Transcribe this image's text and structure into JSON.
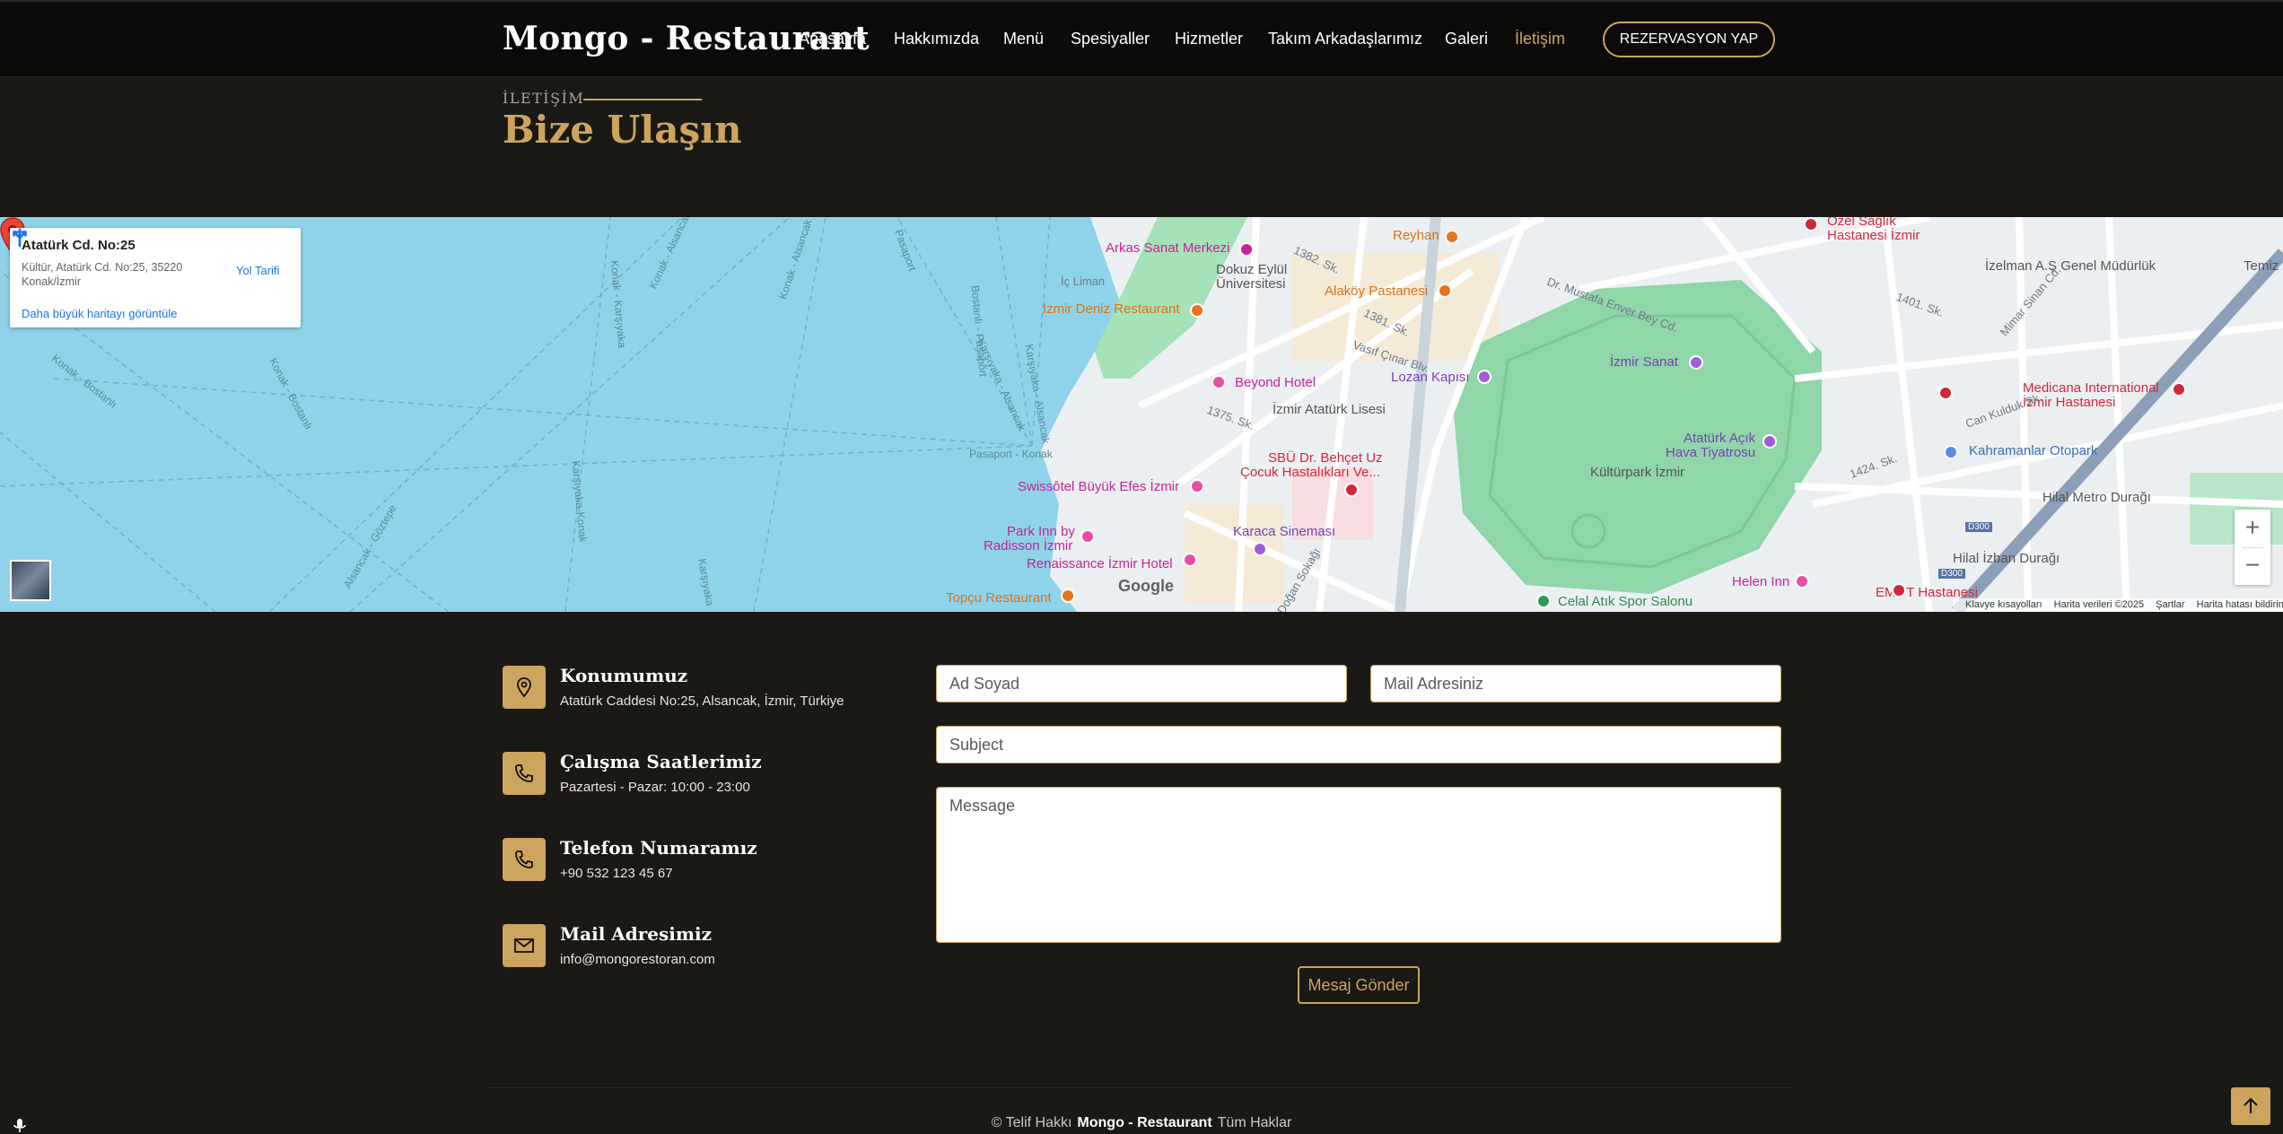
{
  "header": {
    "brand": "Mongo - Restaurant",
    "nav": [
      "Anasayfa",
      "Hakkımızda",
      "Menü",
      "Spesiyaller",
      "Hizmetler",
      "Takım Arkadaşlarımız",
      "Galeri",
      "İletişim"
    ],
    "active_nav": "İletişim",
    "reservation_label": "REZERVASYON YAP"
  },
  "section": {
    "eyebrow": "İLETİŞİM",
    "title": "Bize Ulaşın"
  },
  "map": {
    "card_title": "Atatürk Cd. No:25",
    "card_address": "Kültür, Atatürk Cd. No:25, 35220 Konak/İzmir",
    "directions_label": "Yol Tarifi",
    "bigger_map_link": "Daha büyük haritayı görüntüle",
    "google_logo": "Google",
    "attribution": [
      "Klavye kısayolları",
      "Harita verileri ©2025",
      "Şartlar",
      "Harita hatası bildirin"
    ],
    "labels": {
      "arkas": "Arkas Sanat Merkezi",
      "reyhan": "Reyhan",
      "dokuz1": "Dokuz Eylül",
      "dokuz2": "Üniversitesi",
      "alakoy": "Alaköy Pastanesi",
      "ic_liman": "İç Liman",
      "deniz_rest": "İzmir Deniz Restaurant",
      "beyond": "Beyond Hotel",
      "lozan": "Lozan Kapısı",
      "izmir_sanat": "İzmir Sanat",
      "ataturk_lisesi": "İzmir Atatürk Lisesi",
      "sbu1": "SBÜ Dr. Behçet Uz",
      "sbu2": "Çocuk Hastalıkları Ve...",
      "swissotel": "Swissôtel Büyük Efes İzmir",
      "park_inn1": "Park Inn by",
      "park_inn2": "Radisson İzmir",
      "renaissance": "Renaissance İzmir Hotel",
      "karaca": "Karaca Sineması",
      "topcu": "Topçu Restaurant",
      "kulturpark": "Kültürpark İzmir",
      "acik_hava1": "Atatürk Açık",
      "acik_hava2": "Hava Tiyatrosu",
      "ozel_saglik1": "Özel Sağlık",
      "ozel_saglik2": "Hastanesi İzmir",
      "izelman": "İzelman A.Ş Genel Müdürlük",
      "medicana1": "Medicana International",
      "medicana2": "İzmir Hastanesi",
      "kahramanlar": "Kahramanlar Otopark",
      "hilal_metro": "Hilal Metro Durağı",
      "hilal_izban": "Hilal İzban Durağı",
      "helen": "Helen Inn",
      "emot": "EMOT Hastanesi",
      "celal": "Celal Atık Spor Salonu",
      "pasaport": "Pasaport - Konak",
      "mustafa": "Dr. Mustafa Enver Bey Cd.",
      "vasif": "Vasıf Çınar Blv.",
      "sk1375": "1375. Sk.",
      "sk1382": "1382. Sk.",
      "sk1381": "1381. Sk.",
      "sk1401": "1401. Sk.",
      "sk1424": "1424. Sk.",
      "can_kulduk": "Can Kulduk Sk.",
      "mimar_sinan": "Mimar Sinan Cd.",
      "dogan": "Doğan Sokağı",
      "temiz": "Temiz",
      "d300": "D300",
      "sea_konak_bostanli": "Konak - Bostanlı",
      "sea_konak_karsiyaka": "Konak - Karşıyaka",
      "sea_karsiyaka_konak": "Karşıyaka-Konak",
      "sea_alsancak": "Alsancak - Göztepe",
      "sea_pasaport": "Pasaport",
      "sea_bostanli_pasaport": "Bostanlı - Pasaport",
      "sea_karsiyaka_alsancak": "Karşıyaka - Alsancak",
      "sea_konak": "Konak - Alsancak",
      "sea_karsiyaka": "Karşıyaka"
    }
  },
  "contact": {
    "items": [
      {
        "title": "Konumumuz",
        "text": "Atatürk Caddesi No:25, Alsancak, İzmir, Türkiye"
      },
      {
        "title": "Çalışma Saatlerimiz",
        "text": "Pazartesi - Pazar: 10:00 - 23:00"
      },
      {
        "title": "Telefon Numaramız",
        "text": "+90 532 123 45 67"
      },
      {
        "title": "Mail Adresimiz",
        "text": "info@mongorestoran.com"
      }
    ],
    "form": {
      "name_placeholder": "Ad Soyad",
      "email_placeholder": "Mail Adresiniz",
      "subject_placeholder": "Subject",
      "message_placeholder": "Message",
      "send_label": "Mesaj Gönder"
    }
  },
  "footer": {
    "prefix": "© Telif Hakkı",
    "brand": "Mongo - Restaurant",
    "suffix": "Tüm Haklar"
  },
  "colors": {
    "accent": "#cda45e",
    "background": "#1b1916",
    "header": "#0c0b0a",
    "water": "#8ed3ea",
    "park": "#8fd6a8"
  },
  "icons": [
    "location-pin-icon",
    "phone-icon",
    "envelope-icon",
    "directions-icon",
    "arrow-up-icon",
    "microphone-icon",
    "map-marker-icon"
  ]
}
